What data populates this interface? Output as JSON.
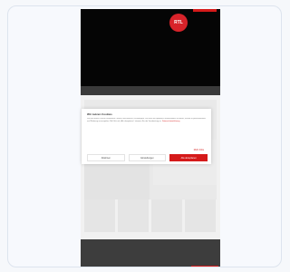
{
  "brand": {
    "logo_text": "RTL",
    "accent_color": "#d51a1a"
  },
  "cookie_banner": {
    "title": "Wir nutzen Cookies",
    "body": "Wir und unsere Partner verwenden Cookies und ähnliche Technologien, um Ihnen ein optimales Nutzererlebnis zu bieten, Inhalte zu personalisieren und Werbung auszuspielen. Mit Klick auf „Alle akzeptieren“ stimmen Sie der Verarbeitung zu.",
    "privacy_link": "Datenschutzerklärung",
    "more_link": "Mehr Infos",
    "buttons": {
      "reject": "Ablehnen",
      "settings": "Einstellungen",
      "accept": "Alle akzeptieren"
    }
  }
}
